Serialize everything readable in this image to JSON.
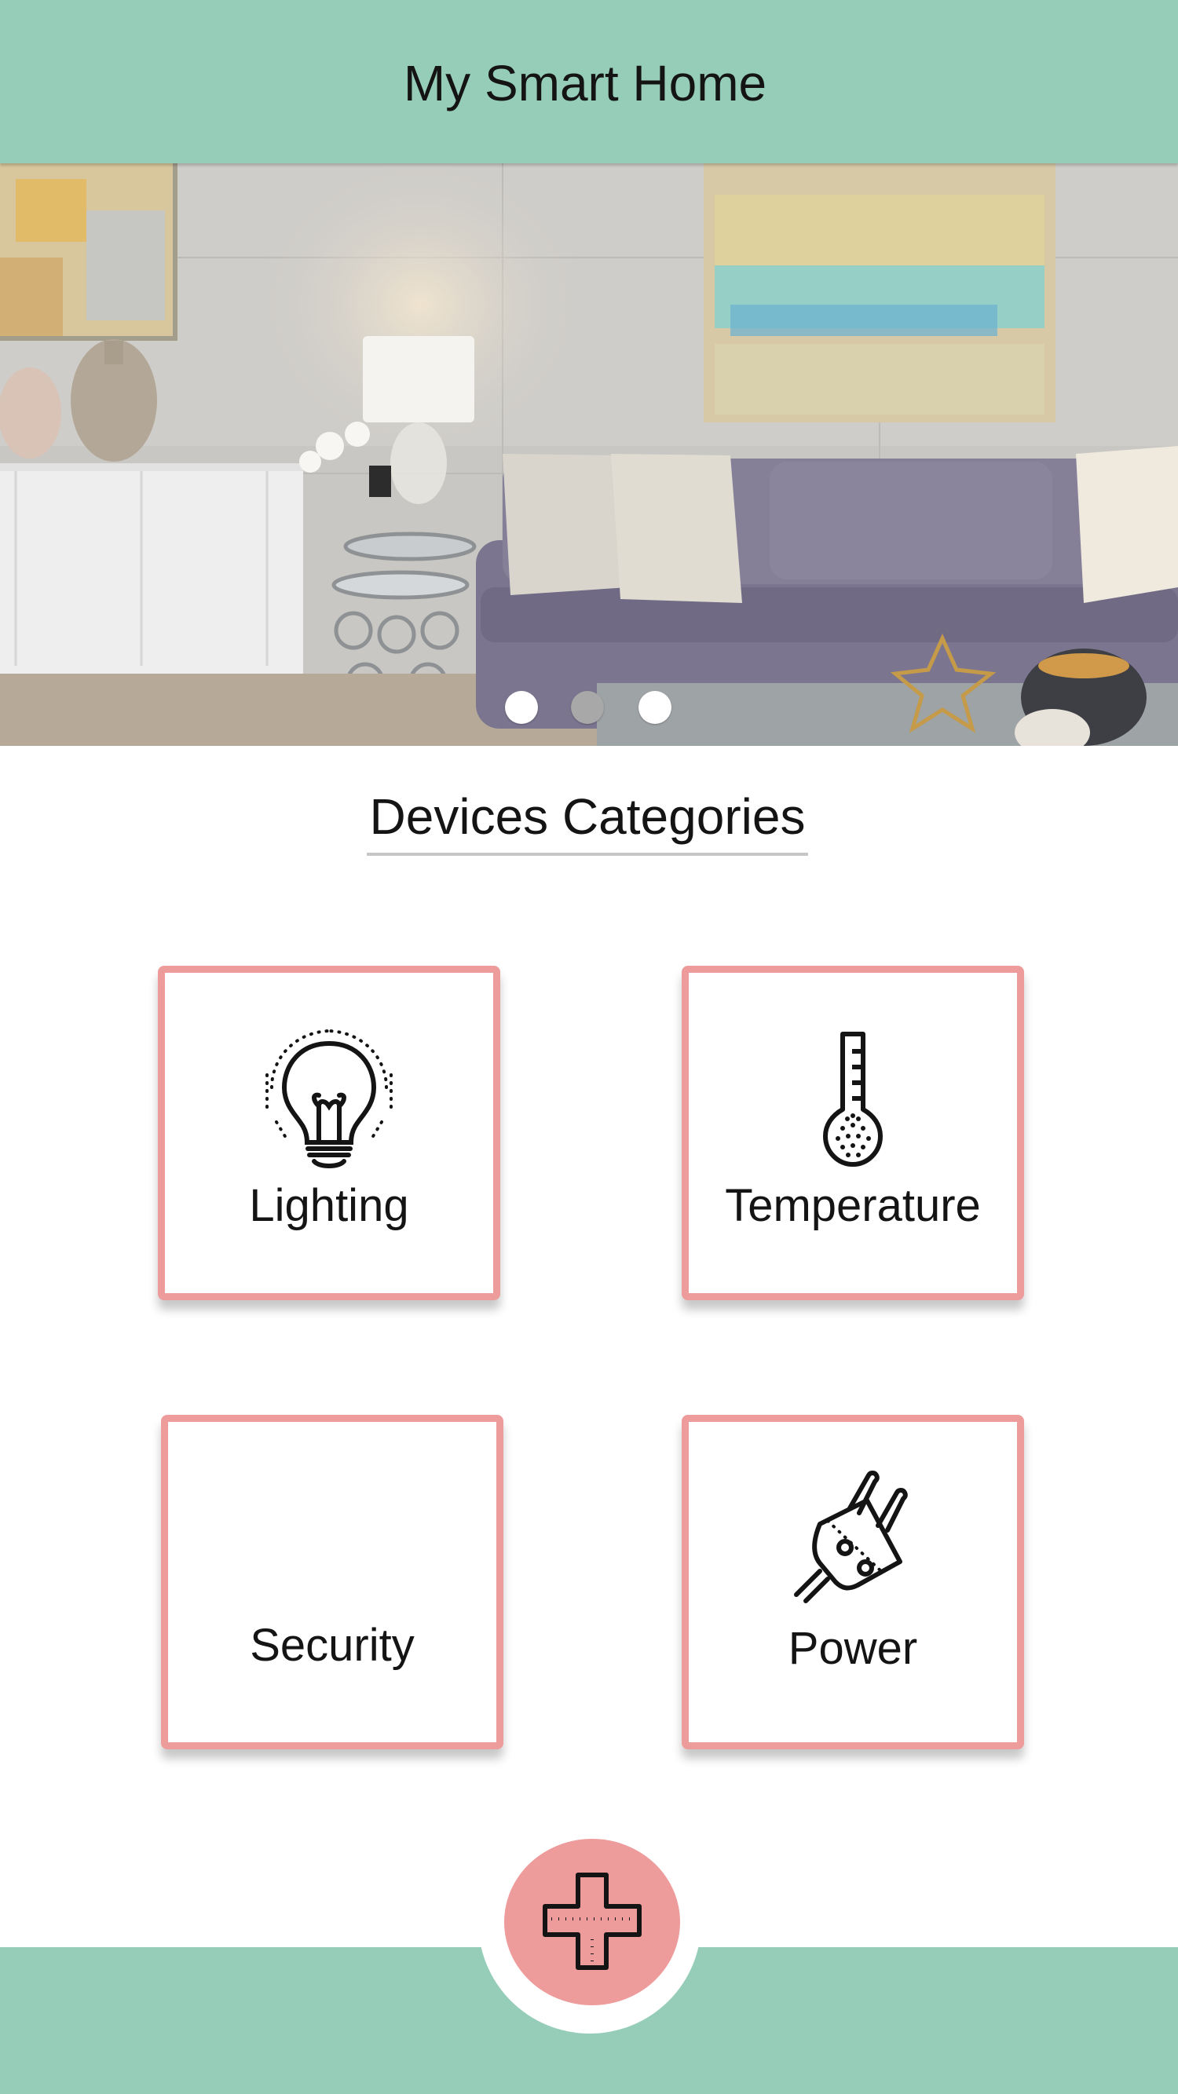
{
  "app": {
    "title": "My Smart Home"
  },
  "hero": {
    "slide_count": 3,
    "active_slide": 2
  },
  "section": {
    "title": "Devices Categories"
  },
  "categories": [
    {
      "label": "Lighting",
      "icon": "light-bulb-icon"
    },
    {
      "label": "Temperature",
      "icon": "thermometer-icon"
    },
    {
      "label": "Security",
      "icon": ""
    },
    {
      "label": "Power",
      "icon": "power-plug-icon"
    }
  ],
  "fab": {
    "icon": "plus-icon"
  },
  "colors": {
    "header_bg": "#96cdb9",
    "card_border": "#ee9b9b",
    "fab_bg": "#ee9b9b",
    "active_dot": "#a8a8a8"
  }
}
